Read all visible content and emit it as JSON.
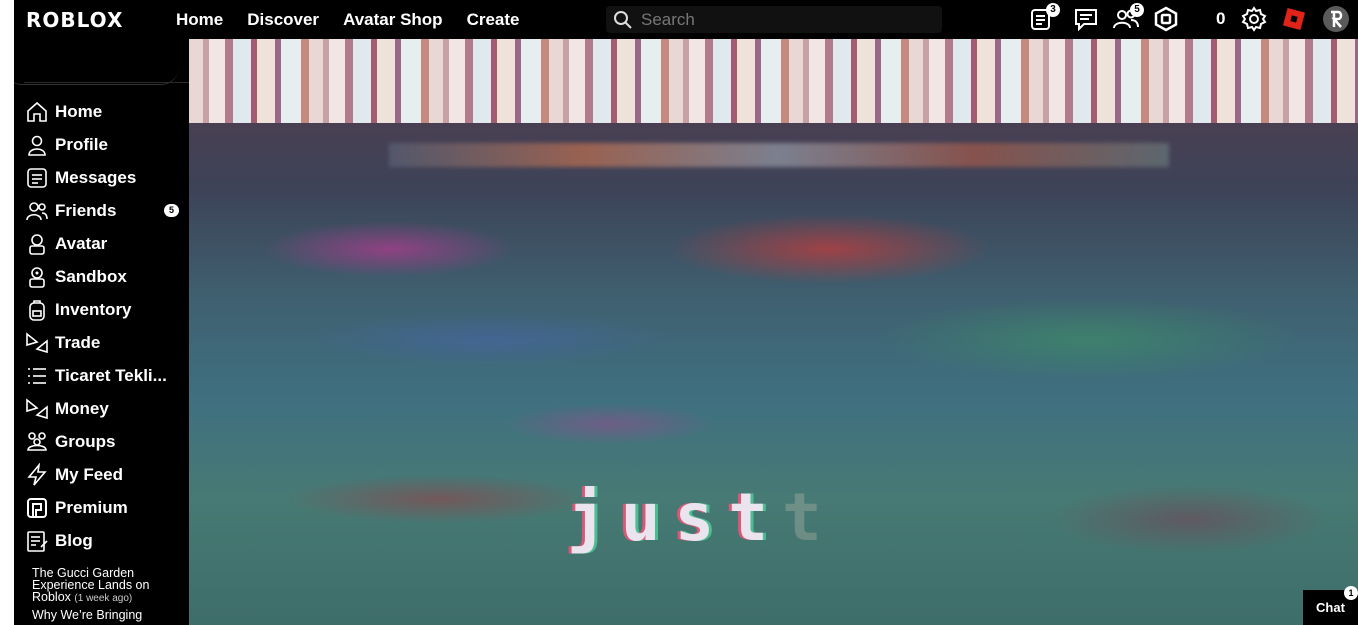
{
  "header": {
    "logo_text": "ROBLOX",
    "nav": [
      "Home",
      "Discover",
      "Avatar Shop",
      "Create"
    ],
    "search_placeholder": "Search",
    "notifications_count": "3",
    "friends_count": "5",
    "robux_count": "0"
  },
  "sidebar": {
    "items": [
      {
        "label": "Home",
        "icon": "home-icon"
      },
      {
        "label": "Profile",
        "icon": "profile-icon"
      },
      {
        "label": "Messages",
        "icon": "messages-icon"
      },
      {
        "label": "Friends",
        "icon": "friends-icon",
        "count": "5"
      },
      {
        "label": "Avatar",
        "icon": "avatar-icon"
      },
      {
        "label": "Sandbox",
        "icon": "sandbox-icon"
      },
      {
        "label": "Inventory",
        "icon": "inventory-icon"
      },
      {
        "label": "Trade",
        "icon": "trade-icon"
      },
      {
        "label": "Ticaret Tekli...",
        "icon": "list-icon"
      },
      {
        "label": "Money",
        "icon": "money-icon"
      },
      {
        "label": "Groups",
        "icon": "groups-icon"
      },
      {
        "label": "My Feed",
        "icon": "feed-icon"
      },
      {
        "label": "Premium",
        "icon": "premium-icon"
      },
      {
        "label": "Blog",
        "icon": "blog-icon"
      }
    ],
    "blog_posts": [
      {
        "title": "The Gucci Garden Experience Lands on Roblox",
        "age": "(1 week ago)"
      },
      {
        "title": "Why We’re Bringing",
        "age": ""
      }
    ]
  },
  "hero": {
    "text": "just",
    "fade_text": "t"
  },
  "chat": {
    "label": "Chat",
    "count": "1"
  }
}
